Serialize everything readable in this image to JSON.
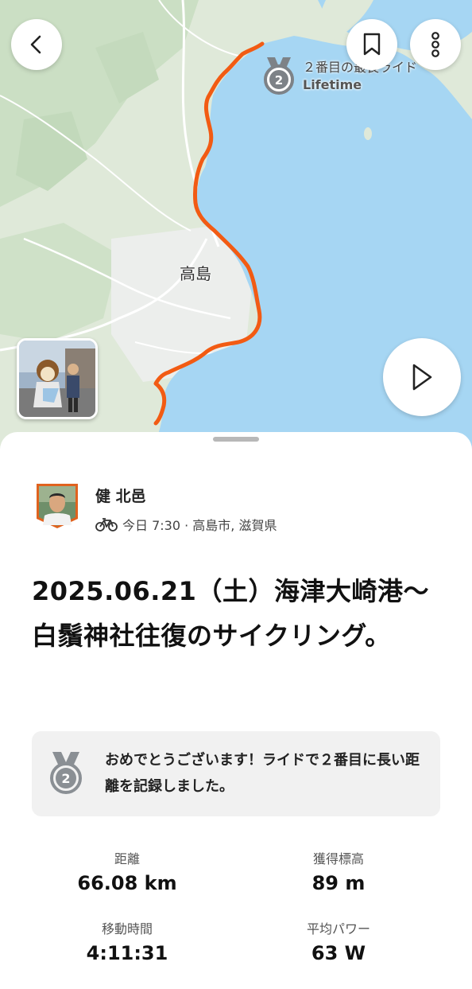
{
  "map": {
    "town_label": "高島",
    "achievement_rank": "2",
    "achievement_title": "２番目の最長ライド",
    "achievement_sub": "Lifetime"
  },
  "athlete": {
    "name": "健 北邑",
    "meta": "今日 7:30 · 高島市, 滋賀県"
  },
  "activity": {
    "title": "2025.06.21（土）海津大崎港〜白鬚神社往復のサイクリング。"
  },
  "banner": {
    "rank": "2",
    "message": "おめでとうございます！ライドで２番目に長い距離を記録しました。"
  },
  "stats": [
    {
      "label": "距離",
      "value": "66.08 km"
    },
    {
      "label": "獲得標高",
      "value": "89 m"
    },
    {
      "label": "移動時間",
      "value": "4:11:31"
    },
    {
      "label": "平均パワー",
      "value": "63 W"
    }
  ],
  "colors": {
    "route": "#f25b13",
    "water": "#a6d6f3",
    "land": "#dfe9d9",
    "forest": "#c6dcc0",
    "urban": "#e8eae8",
    "medal": "#858a8e"
  }
}
